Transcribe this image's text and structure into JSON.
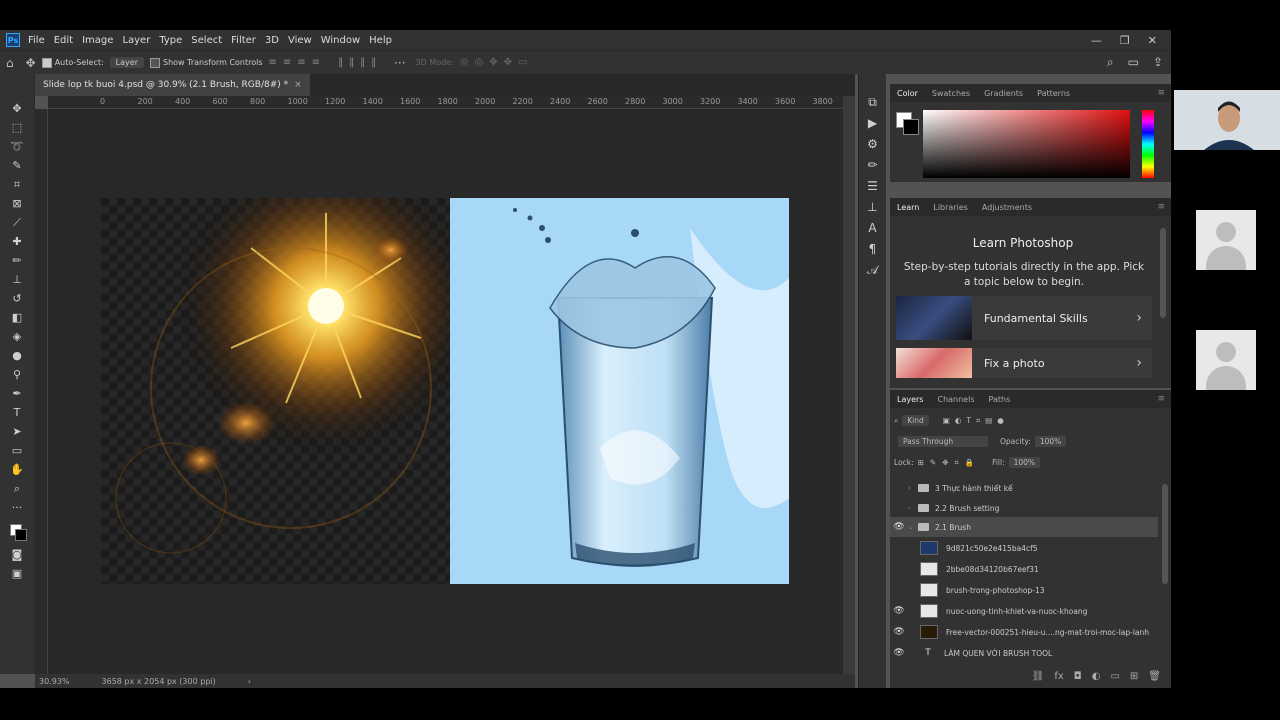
{
  "menu": [
    "File",
    "Edit",
    "Image",
    "Layer",
    "Type",
    "Select",
    "Filter",
    "3D",
    "View",
    "Window",
    "Help"
  ],
  "window_controls": {
    "minimize": "—",
    "restore": "❐",
    "close": "✕"
  },
  "options": {
    "auto_select_label": "Auto-Select:",
    "auto_select_target": "Layer",
    "transform_label": "Show Transform Controls",
    "mode_3d": "3D Mode:"
  },
  "document": {
    "tab_title": "Slide lop tk buoi 4.psd @ 30.9% (2.1 Brush, RGB/8#) *",
    "close": "×"
  },
  "ruler_marks": [
    "0",
    "200",
    "400",
    "600",
    "800",
    "1000",
    "1200",
    "1400",
    "1600",
    "1800",
    "2000",
    "2200",
    "2400",
    "2600",
    "2800",
    "3000",
    "3200",
    "3400",
    "3600",
    "3800"
  ],
  "status": {
    "zoom": "30.93%",
    "size": "3658 px x 2054 px (300 ppi)",
    "arrow": "›"
  },
  "color_panel": {
    "tabs": [
      "Color",
      "Swatches",
      "Gradients",
      "Patterns"
    ],
    "active": 0
  },
  "learn_panel": {
    "tabs": [
      "Learn",
      "Libraries",
      "Adjustments"
    ],
    "title": "Learn Photoshop",
    "description": "Step-by-step tutorials directly in the app. Pick a topic below to begin.",
    "cards": [
      {
        "label": "Fundamental Skills",
        "chevron": "›"
      },
      {
        "label": "Fix a photo",
        "chevron": "›"
      }
    ]
  },
  "layers_panel": {
    "tabs": [
      "Layers",
      "Channels",
      "Paths"
    ],
    "filter": "Kind",
    "blend_mode": "Pass Through",
    "opacity_label": "Opacity:",
    "opacity": "100%",
    "lock_label": "Lock:",
    "fill_label": "Fill:",
    "fill": "100%",
    "layers": [
      {
        "name": "3 Thực hành thiết kế",
        "type": "group",
        "visible": false,
        "selected": false
      },
      {
        "name": "2.2 Brush setting",
        "type": "group",
        "visible": false,
        "selected": false
      },
      {
        "name": "2.1 Brush",
        "type": "group",
        "visible": true,
        "selected": true
      },
      {
        "name": "9d821c50e2e415ba4cf5",
        "type": "smart",
        "visible": false,
        "selected": false
      },
      {
        "name": "2bbe08d34120b67eef31",
        "type": "smart",
        "visible": false,
        "selected": false
      },
      {
        "name": "brush-trong-photoshop-13",
        "type": "smart",
        "visible": false,
        "selected": false
      },
      {
        "name": "nuoc-uong-tinh-khiet-va-nuoc-khoang",
        "type": "smart",
        "visible": true,
        "selected": false
      },
      {
        "name": "Free-vector-000251-hieu-u....ng-mat-troi-moc-lap-lanh",
        "type": "smart",
        "visible": true,
        "selected": false
      },
      {
        "name": "LÀM QUEN VỚI BRUSH TOOL",
        "type": "text",
        "visible": true,
        "selected": false
      }
    ]
  },
  "colors": {
    "accent": "#31a8ff",
    "panel": "#323232",
    "canvas_bg": "#282828"
  }
}
